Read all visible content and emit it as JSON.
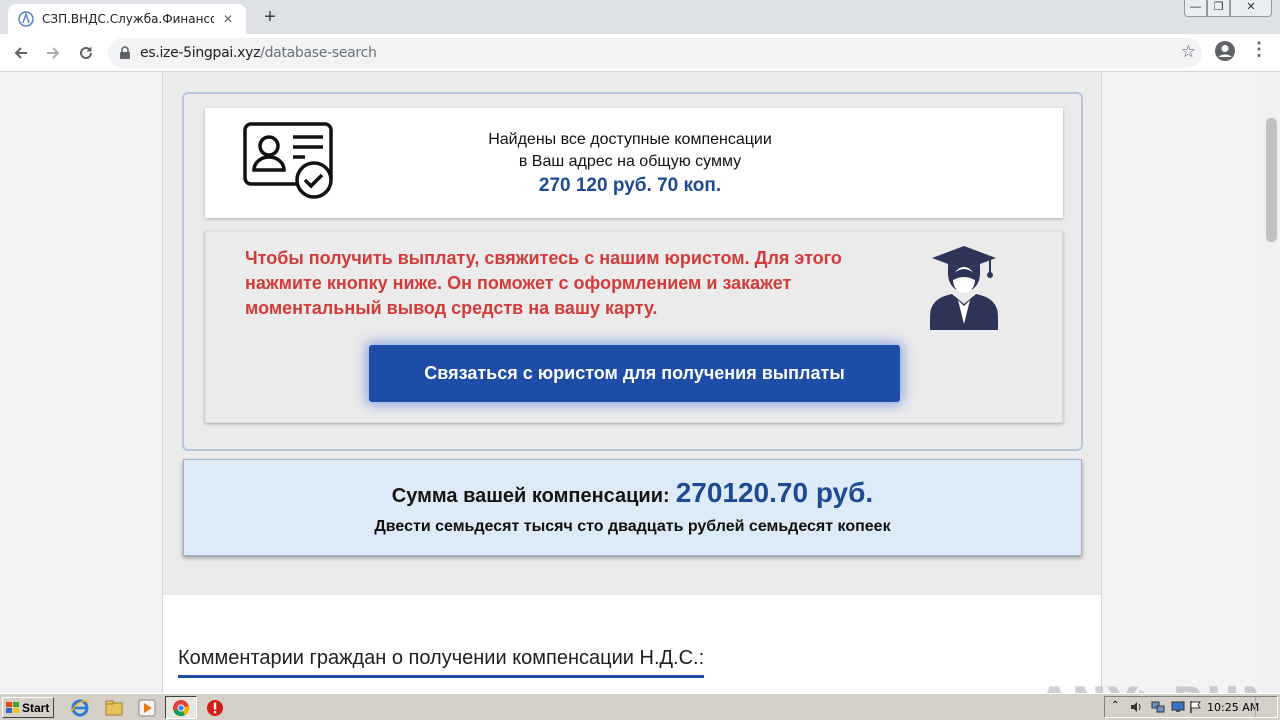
{
  "browser": {
    "tab_title": "СЗП.ВНДС.Служба.Финансовой.Зац",
    "tab_close": "✕",
    "new_tab": "+",
    "url_domain": "es.ize-5ingpai.xyz",
    "url_path": "/database-search",
    "window_controls": {
      "minimize": "—",
      "restore": "❐",
      "close": "✕"
    }
  },
  "found_card": {
    "line1": "Найдены все доступные компенсации",
    "line2": "в Ваш адрес на общую сумму",
    "amount": "270 120 руб. 70 коп."
  },
  "lawyer_card": {
    "message": "Чтобы получить выплату, свяжитесь с нашим юристом. Для этого нажмите кнопку ниже. Он поможет с оформлением и закажет моментальный вывод средств на вашу карту.",
    "button_label": "Связаться с юристом для получения выплаты"
  },
  "sum_card": {
    "label": "Сумма вашей компенсации:",
    "value": "270120.70 руб.",
    "words": "Двести семьдесят тысяч сто двадцать рублей семьдесят копеек"
  },
  "comments": {
    "title": "Комментарии граждан о получении компенсации Н.Д.С.:"
  },
  "watermark": "ANY▷RUN",
  "taskbar": {
    "start_label": "Start",
    "clock": "10:25 AM"
  },
  "colors": {
    "accent_blue": "#1e4da8",
    "amount_blue": "#1d4a93",
    "warning_red": "#d33a3a",
    "sum_card_bg": "#dcebf7"
  },
  "icons": [
    "certificate-icon",
    "graduate-icon",
    "lock-icon",
    "star-icon",
    "profile-icon",
    "back-icon",
    "forward-icon",
    "reload-icon"
  ]
}
